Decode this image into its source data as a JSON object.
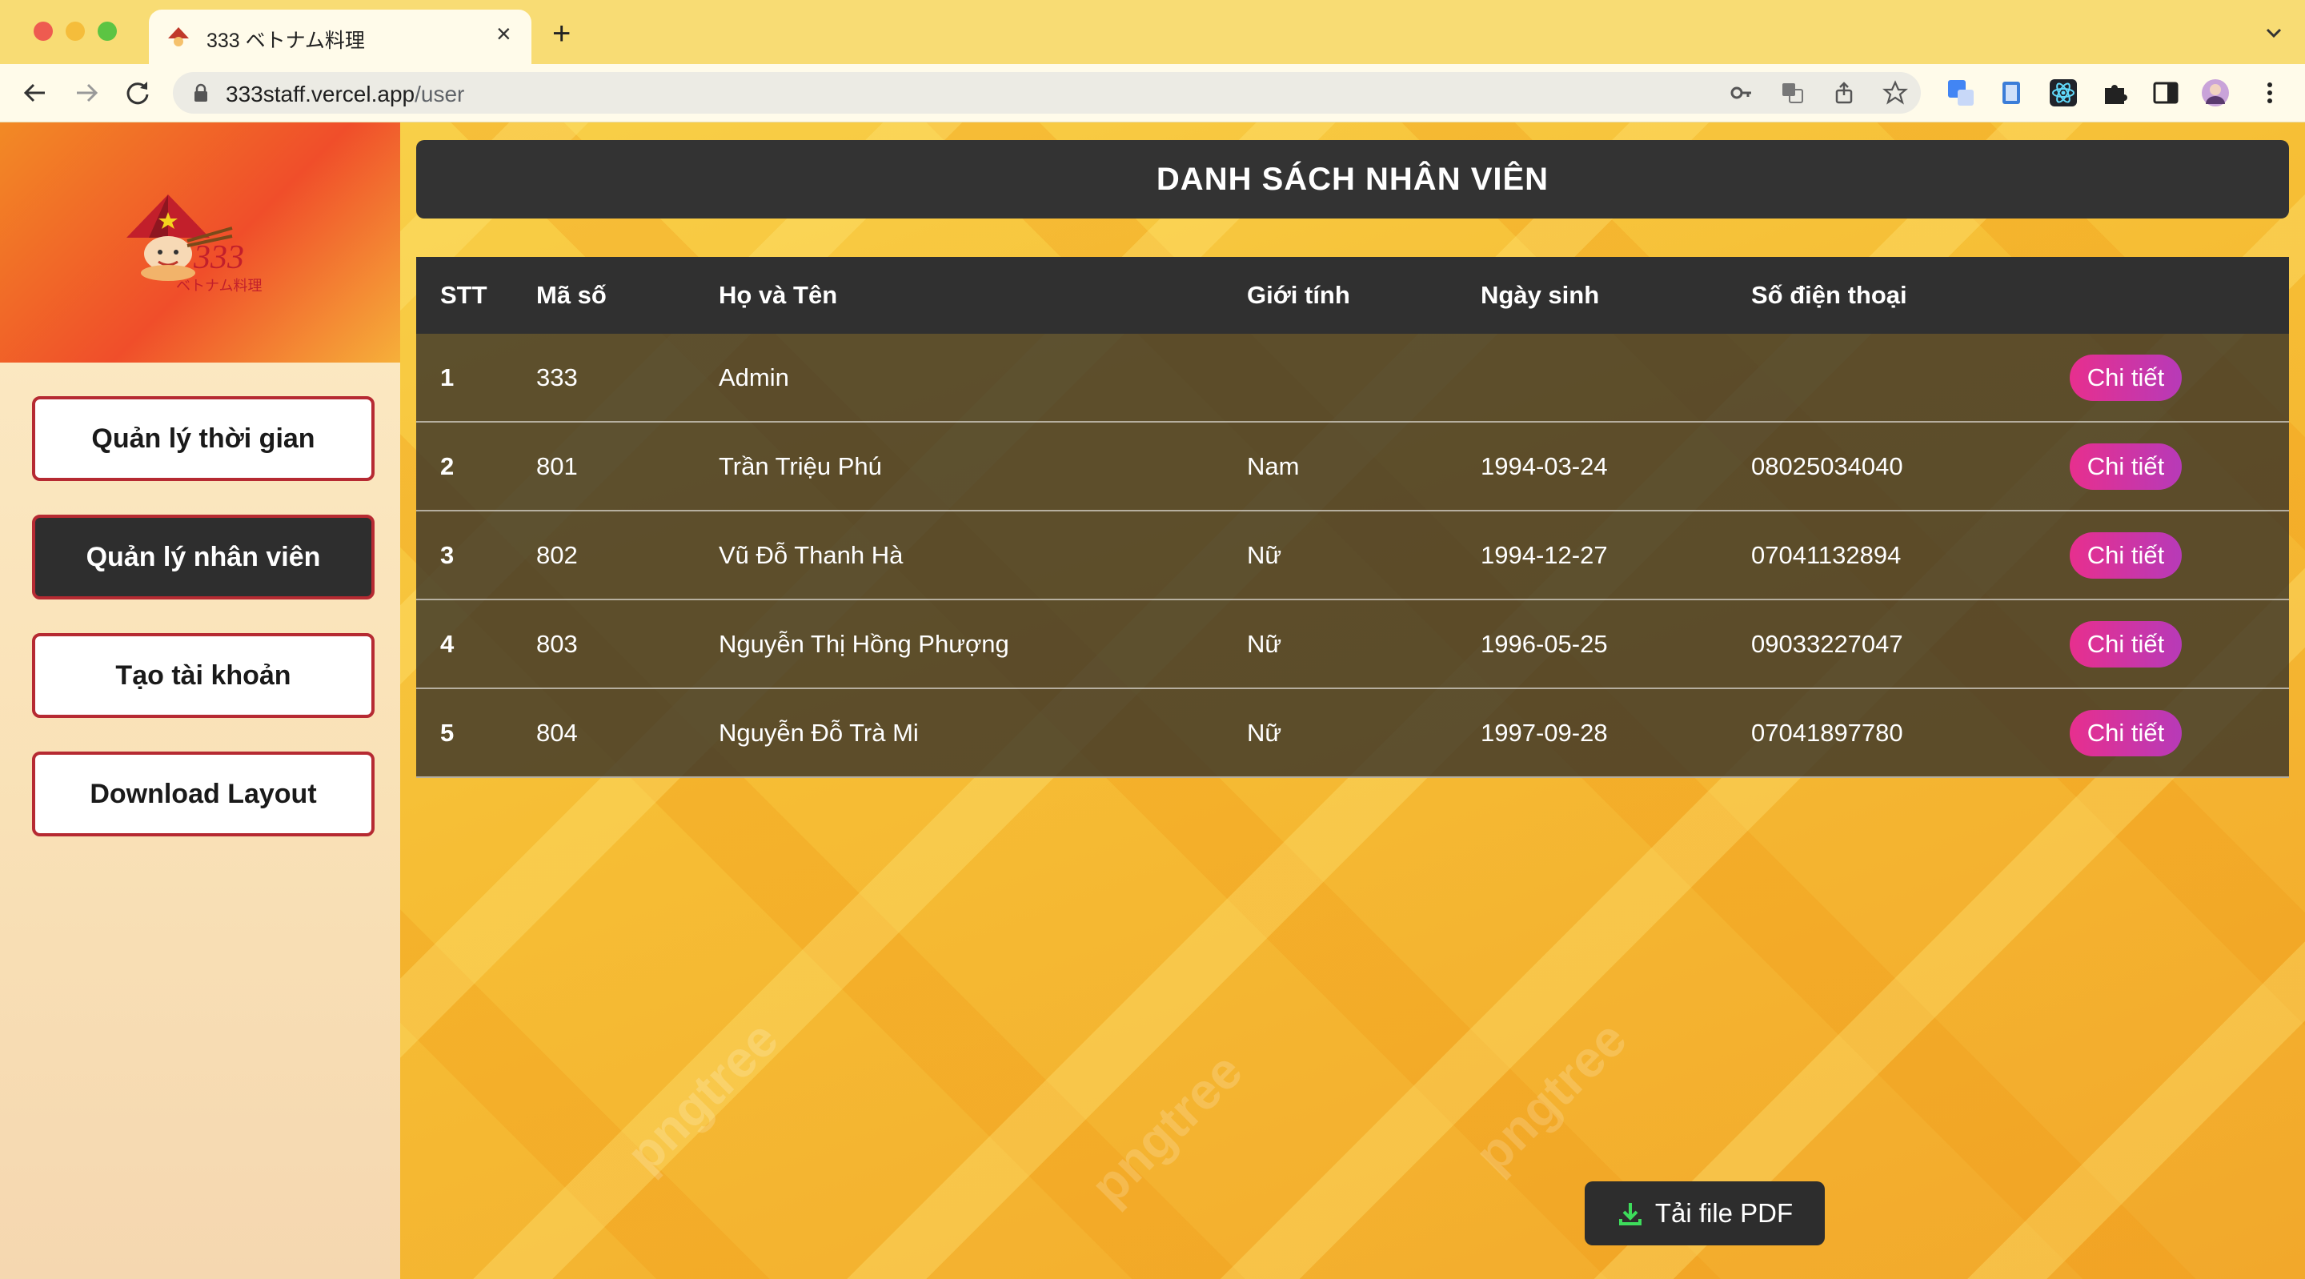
{
  "browser": {
    "tab_title": "333 ベトナム料理",
    "url_host": "333staff.vercel.app",
    "url_path": "/user"
  },
  "sidebar": {
    "logo_text": "333",
    "logo_sub": "ベトナム料理",
    "items": [
      {
        "label": "Quản lý thời gian",
        "active": false
      },
      {
        "label": "Quản lý nhân viên",
        "active": true
      },
      {
        "label": "Tạo tài khoản",
        "active": false
      },
      {
        "label": "Download Layout",
        "active": false
      }
    ]
  },
  "main": {
    "title": "DANH SÁCH NHÂN VIÊN",
    "columns": [
      "STT",
      "Mã số",
      "Họ và Tên",
      "Giới tính",
      "Ngày sinh",
      "Số điện thoại"
    ],
    "detail_label": "Chi tiết",
    "rows": [
      {
        "stt": "1",
        "ma": "333",
        "name": "Admin",
        "gender": "",
        "dob": "",
        "phone": ""
      },
      {
        "stt": "2",
        "ma": "801",
        "name": "Trần Triệu Phú",
        "gender": "Nam",
        "dob": "1994-03-24",
        "phone": "08025034040"
      },
      {
        "stt": "3",
        "ma": "802",
        "name": "Vũ Đỗ Thanh Hà",
        "gender": "Nữ",
        "dob": "1994-12-27",
        "phone": "07041132894"
      },
      {
        "stt": "4",
        "ma": "803",
        "name": "Nguyễn Thị Hồng Phượng",
        "gender": "Nữ",
        "dob": "1996-05-25",
        "phone": "09033227047"
      },
      {
        "stt": "5",
        "ma": "804",
        "name": "Nguyễn Đỗ Trà Mi",
        "gender": "Nữ",
        "dob": "1997-09-28",
        "phone": "07041897780"
      }
    ],
    "pdf_label": "Tải file PDF",
    "watermark": "pngtree"
  },
  "colors": {
    "accent_button": "#e72f8e",
    "sidebar_border": "#b62a32",
    "dark": "#333333"
  }
}
